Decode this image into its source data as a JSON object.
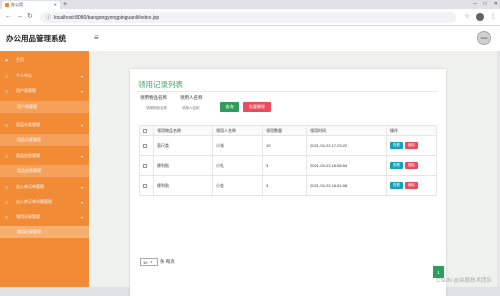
{
  "browser": {
    "tab_title": "办公用",
    "url": "localhost:8080/bangongyongpinguanli/index.jsp"
  },
  "app": {
    "title": "办公用品管理系统",
    "avatar_text": "Tools"
  },
  "sidebar": {
    "items": [
      {
        "label": "主页",
        "icon": "flag-icon",
        "type": "group"
      },
      {
        "label": "个人中心",
        "icon": "menu-icon",
        "type": "group"
      },
      {
        "label": "用户表管理",
        "icon": "menu-icon",
        "type": "group"
      },
      {
        "label": "用户表管理",
        "type": "sub"
      },
      {
        "label": "用品分类管理",
        "icon": "menu-icon",
        "type": "group"
      },
      {
        "label": "用品分类管理",
        "type": "sub"
      },
      {
        "label": "用品信息管理",
        "icon": "menu-icon",
        "type": "group"
      },
      {
        "label": "用品信息管理",
        "type": "sub"
      },
      {
        "label": "出入库订单管理",
        "icon": "menu-icon",
        "type": "group"
      },
      {
        "label": "出入库订单详情管理",
        "icon": "menu-icon",
        "type": "group"
      },
      {
        "label": "领用记录管理",
        "icon": "menu-icon",
        "type": "group"
      },
      {
        "label": "领用记录管理",
        "type": "sub"
      }
    ]
  },
  "main": {
    "title": "领用记录列表",
    "search": {
      "item_label": "领用物品名称",
      "item_placeholder": "领用物品名称",
      "person_label": "领用人名称",
      "person_placeholder": "领用人名称",
      "search_button": "查询",
      "batch_delete_button": "批量删除"
    },
    "table": {
      "headers": [
        "领用物品名称",
        "领用人名称",
        "领用数量",
        "领用时间",
        "操作"
      ],
      "rows": [
        {
          "item": "直尺类",
          "person": "小张",
          "qty": "10",
          "time": "2021-03-23 17:23:22"
        },
        {
          "item": "便利贴",
          "person": "小礼",
          "qty": "3",
          "time": "2021-03-23 16:58:54"
        },
        {
          "item": "便利贴",
          "person": "小金",
          "qty": "3",
          "time": "2021-03-23 16:51:08"
        }
      ],
      "view_label": "查看",
      "delete_label": "删除"
    },
    "pager": {
      "page_size": "10",
      "per_page_label": "条 每页",
      "current_page": "1"
    }
  },
  "watermark": "CSDN @央顺技术团队"
}
